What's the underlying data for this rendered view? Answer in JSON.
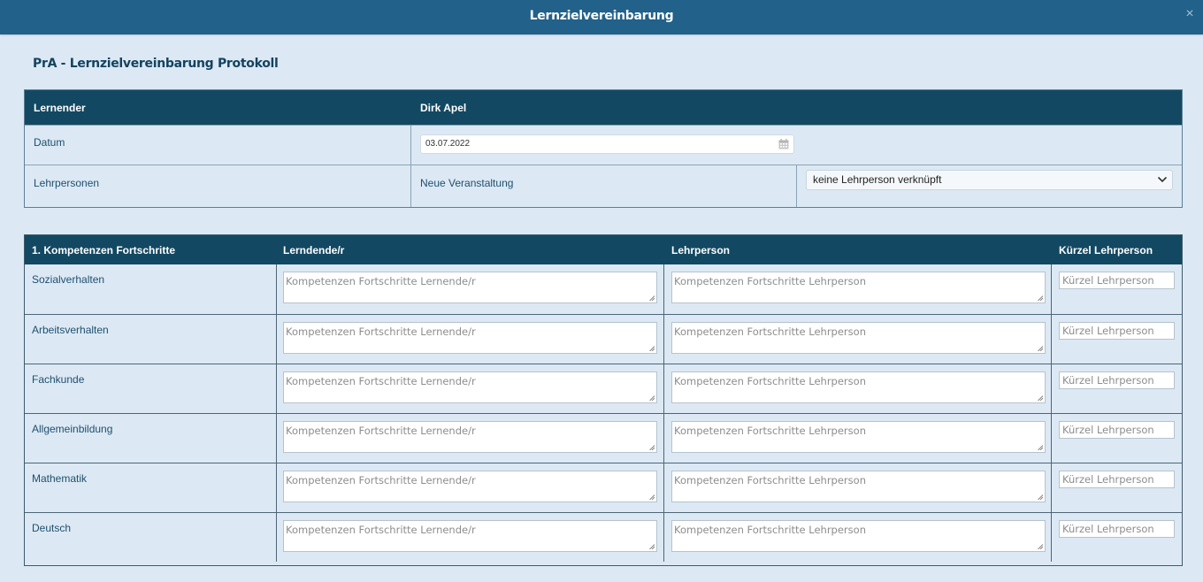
{
  "window": {
    "title": "Lernzielvereinbarung",
    "close_label": "×"
  },
  "page": {
    "heading": "PrA - Lernzielvereinbarung Protokoll"
  },
  "info_table": {
    "header_label": "Lernender",
    "header_value": "Dirk Apel",
    "date_label": "Datum",
    "date_value": "03.07.2022",
    "teachers_label": "Lehrpersonen",
    "event_label": "Neue Veranstaltung",
    "teacher_select_value": "keine Lehrperson verknüpft"
  },
  "competence_table": {
    "headers": [
      "1. Kompetenzen Fortschritte",
      "Lerndende/r",
      "Lehrperson",
      "Kürzel Lehrperson"
    ],
    "rows": [
      {
        "label": "Sozialverhalten",
        "learner_placeholder": "Kompetenzen Fortschritte Lernende/r",
        "teacher_placeholder": "Kompetenzen Fortschritte Lehrperson",
        "short_placeholder": "Kürzel Lehrperson"
      },
      {
        "label": "Arbeitsverhalten",
        "learner_placeholder": "Kompetenzen Fortschritte Lernende/r",
        "teacher_placeholder": "Kompetenzen Fortschritte Lehrperson",
        "short_placeholder": "Kürzel Lehrperson"
      },
      {
        "label": "Fachkunde",
        "learner_placeholder": "Kompetenzen Fortschritte Lernende/r",
        "teacher_placeholder": "Kompetenzen Fortschritte Lehrperson",
        "short_placeholder": "Kürzel Lehrperson"
      },
      {
        "label": "Allgemeinbildung",
        "learner_placeholder": "Kompetenzen Fortschritte Lernende/r",
        "teacher_placeholder": "Kompetenzen Fortschritte Lehrperson",
        "short_placeholder": "Kürzel Lehrperson"
      },
      {
        "label": "Mathematik",
        "learner_placeholder": "Kompetenzen Fortschritte Lernende/r",
        "teacher_placeholder": "Kompetenzen Fortschritte Lehrperson",
        "short_placeholder": "Kürzel Lehrperson"
      },
      {
        "label": "Deutsch",
        "learner_placeholder": "Kompetenzen Fortschritte Lernende/r",
        "teacher_placeholder": "Kompetenzen Fortschritte Lehrperson",
        "short_placeholder": "Kürzel Lehrperson"
      }
    ]
  },
  "icons": {
    "close": "close-icon",
    "calendar": "calendar-icon",
    "dropdown": "chevron-down-icon",
    "resize": "resize-grip-icon"
  },
  "colors": {
    "titlebar": "#226189",
    "table_header": "#134862",
    "background": "#dce9f4",
    "label_text": "#1f4f6e"
  }
}
